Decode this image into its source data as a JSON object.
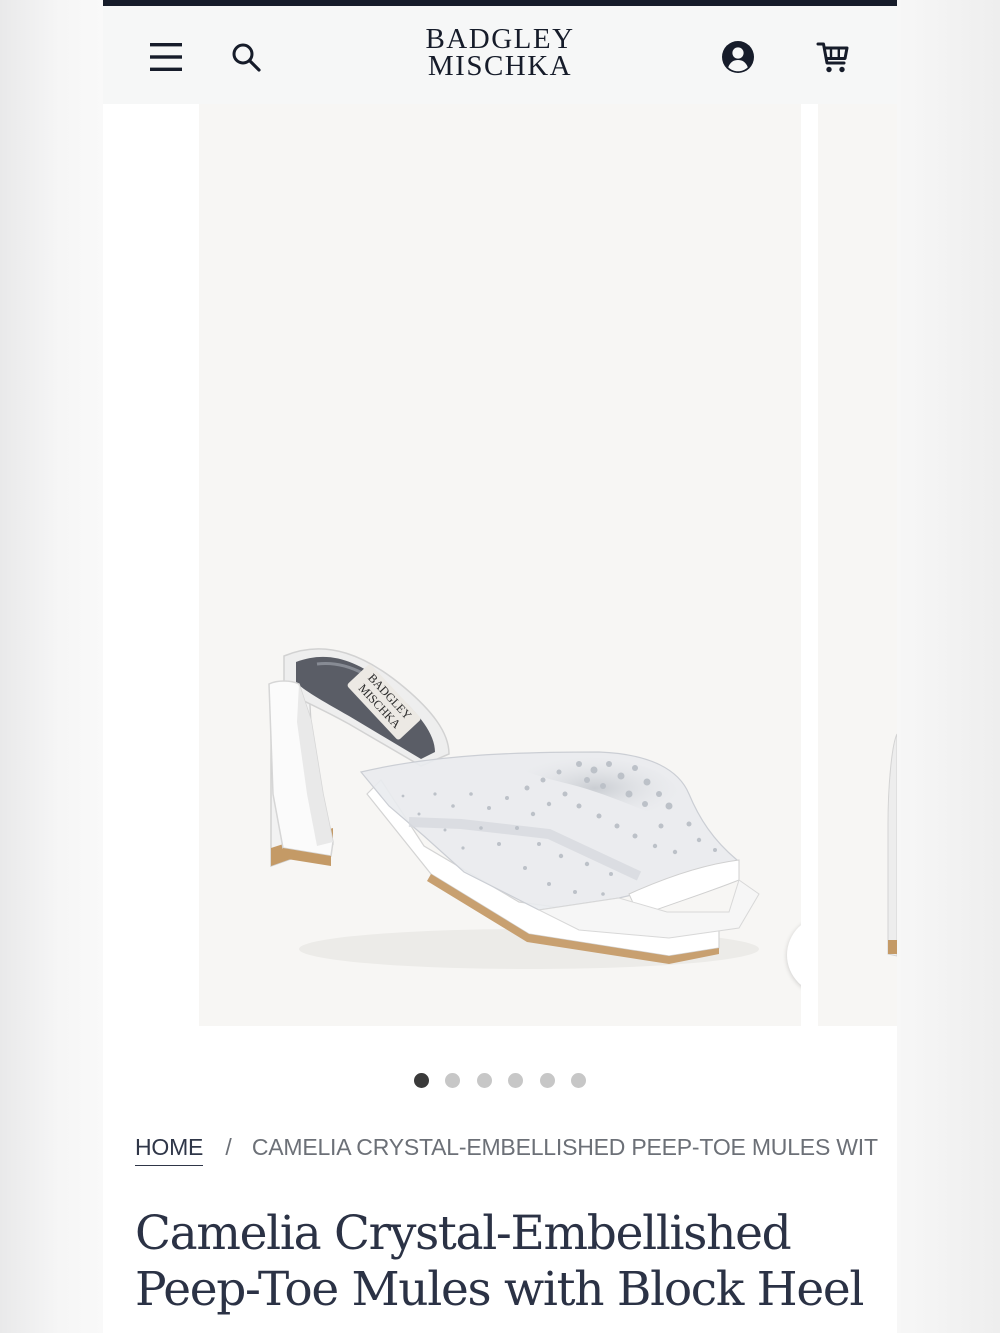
{
  "header": {
    "logo_line1": "BADGLEY",
    "logo_line2": "MISCHKA",
    "menu_icon": "hamburger-menu-icon",
    "search_icon": "search-icon",
    "account_icon": "account-icon",
    "cart_icon": "cart-icon"
  },
  "product_image": {
    "insole_brand_line1": "BADGLEY",
    "insole_brand_line2": "MISCHKA",
    "wishlist_icon": "heart-icon",
    "zoom_icon": "zoom-icon"
  },
  "carousel": {
    "slide_count": 6,
    "active_index": 0
  },
  "breadcrumb": {
    "home": "HOME",
    "separator": "/",
    "current": "CAMELIA CRYSTAL-EMBELLISHED PEEP-TOE MULES WIT"
  },
  "product": {
    "title": "Camelia Crystal-Embellished Peep-Toe Mules with Block Heel"
  },
  "colors": {
    "brand_navy": "#161c2a",
    "title_text": "#2b3245",
    "image_background": "#f7f6f4",
    "dot_active": "#3a3a3a",
    "dot_inactive": "#c7c7c7"
  }
}
